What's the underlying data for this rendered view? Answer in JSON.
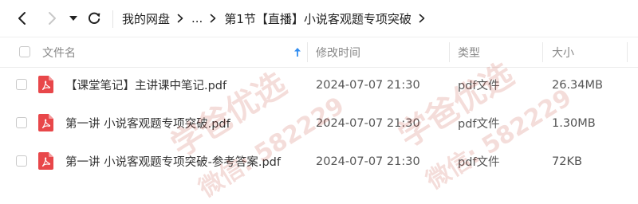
{
  "toolbar": {
    "back_icon": "chevron-left-icon",
    "forward_icon": "chevron-right-icon",
    "history_icon": "caret-down-icon",
    "refresh_icon": "refresh-icon",
    "breadcrumb": {
      "root": "我的网盘",
      "ellipsis": "...",
      "current": "第1节【直播】小说客观题专项突破"
    }
  },
  "table": {
    "headers": {
      "name": "文件名",
      "modified": "修改时间",
      "type": "类型",
      "size": "大小"
    },
    "sort": {
      "column": "name",
      "direction": "ascending",
      "icon": "sort-up-arrow-icon"
    },
    "rows": [
      {
        "name": "【课堂笔记】主讲课中笔记.pdf",
        "modified": "2024-07-07 21:30",
        "type": "pdf文件",
        "size": "26.34MB",
        "icon": "pdf-icon"
      },
      {
        "name": "第一讲 小说客观题专项突破.pdf",
        "modified": "2024-07-07 21:30",
        "type": "pdf文件",
        "size": "1.30MB",
        "icon": "pdf-icon"
      },
      {
        "name": "第一讲 小说客观题专项突破-参考答案.pdf",
        "modified": "2024-07-07 21:30",
        "type": "pdf文件",
        "size": "72KB",
        "icon": "pdf-icon"
      }
    ]
  },
  "colors": {
    "pdf_icon": "#e8474a",
    "sort_arrow": "#2f8cf1",
    "watermark": "#c2301f"
  },
  "watermark": {
    "line1": "学爸优选",
    "line2": "微信: 582229"
  }
}
